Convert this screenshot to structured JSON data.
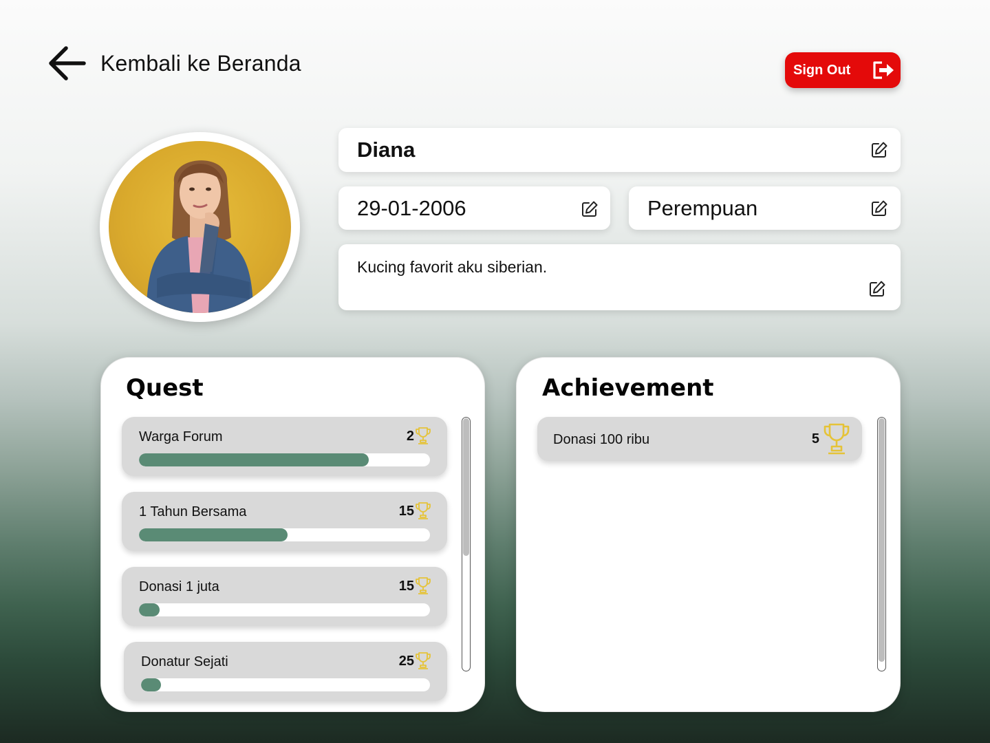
{
  "header": {
    "back_label": "Kembali ke Beranda",
    "signout_label": "Sign Out"
  },
  "profile": {
    "name": "Diana",
    "birth_date": "29-01-2006",
    "gender": "Perempuan",
    "bio": "Kucing favorit aku siberian."
  },
  "quest": {
    "title": "Quest",
    "items": [
      {
        "name": "Warga Forum",
        "points": "2",
        "progress": 0.79
      },
      {
        "name": "1 Tahun Bersama",
        "points": "15",
        "progress": 0.51
      },
      {
        "name": "Donasi 1 juta",
        "points": "15",
        "progress": 0.07
      },
      {
        "name": "Donatur Sejati",
        "points": "25",
        "progress": 0.07
      }
    ]
  },
  "achievement": {
    "title": "Achievement",
    "items": [
      {
        "name": "Donasi 100 ribu",
        "points": "5"
      }
    ]
  },
  "colors": {
    "signout_bg": "#e40a0a",
    "progress_fill": "#5a8b75",
    "card_bg": "#d9d9d9",
    "trophy": "#e5c338"
  },
  "icons": {
    "back": "arrow-left-icon",
    "signout": "logout-icon",
    "edit": "edit-pencil-icon",
    "trophy": "trophy-icon"
  }
}
